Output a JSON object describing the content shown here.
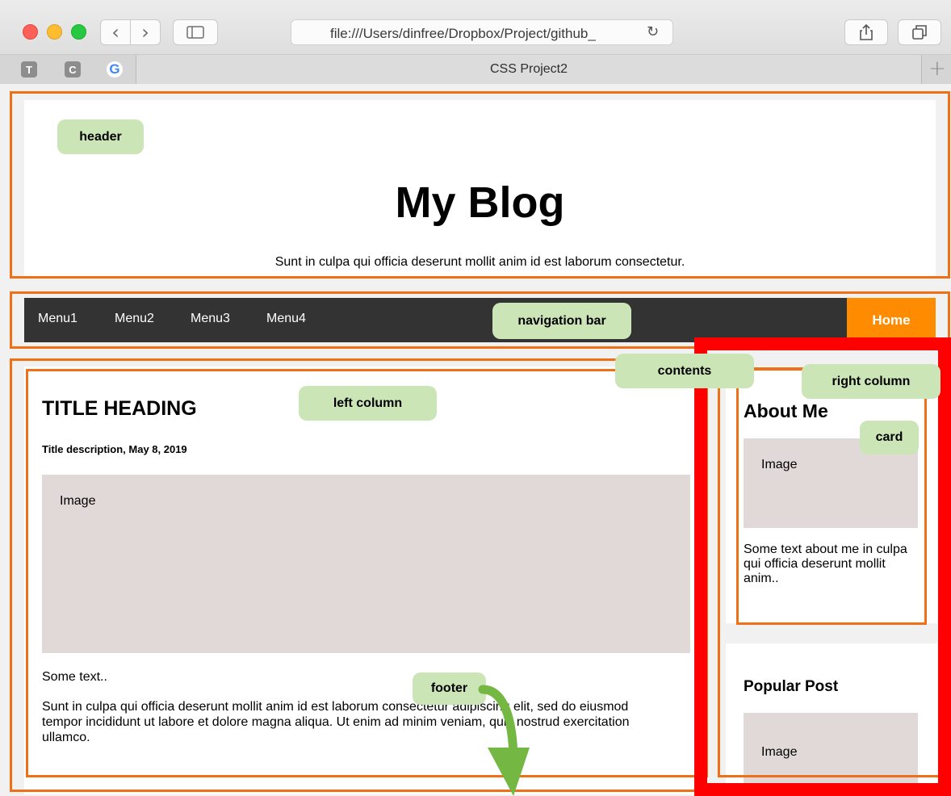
{
  "browser": {
    "address": "file:///Users/dinfree/Dropbox/Project/github_",
    "tab_title": "CSS Project2",
    "favicons": [
      "T",
      "C",
      "G"
    ],
    "new_tab": "+",
    "back": "‹",
    "forward": "›",
    "reload": "↻"
  },
  "header": {
    "title": "My Blog",
    "subtitle": "Sunt in culpa qui officia deserunt mollit anim id est laborum consectetur."
  },
  "nav": {
    "items": [
      "Menu1",
      "Menu2",
      "Menu3",
      "Menu4"
    ],
    "home": "Home"
  },
  "left": {
    "heading": "TITLE HEADING",
    "description": "Title description, May 8, 2019",
    "image_label": "Image",
    "some_text": "Some text..",
    "body": "Sunt in culpa qui officia deserunt mollit anim id est laborum consectetur adipiscing elit, sed do eiusmod tempor incididunt ut labore et dolore magna aliqua. Ut enim ad minim veniam, quis nostrud exercitation ullamco."
  },
  "right": {
    "about_title": "About Me",
    "about_image_label": "Image",
    "about_text": "Some text about me in culpa qui officia deserunt mollit anim..",
    "popular_title": "Popular Post",
    "popular_image_label": "Image"
  },
  "annotations": {
    "header": "header",
    "navigation_bar": "navigation bar",
    "contents": "contents",
    "left_column": "left column",
    "right_column": "right column",
    "card": "card",
    "footer": "footer"
  },
  "colors": {
    "nav_bg": "#333333",
    "home_bg": "#ff8b00",
    "annotation_outline": "#f07018",
    "annotation_highlight": "#ff0000",
    "annotation_label_bg": "#cce5b7",
    "image_placeholder": "#e1d8d8",
    "page_bg": "#f1f1f1"
  }
}
